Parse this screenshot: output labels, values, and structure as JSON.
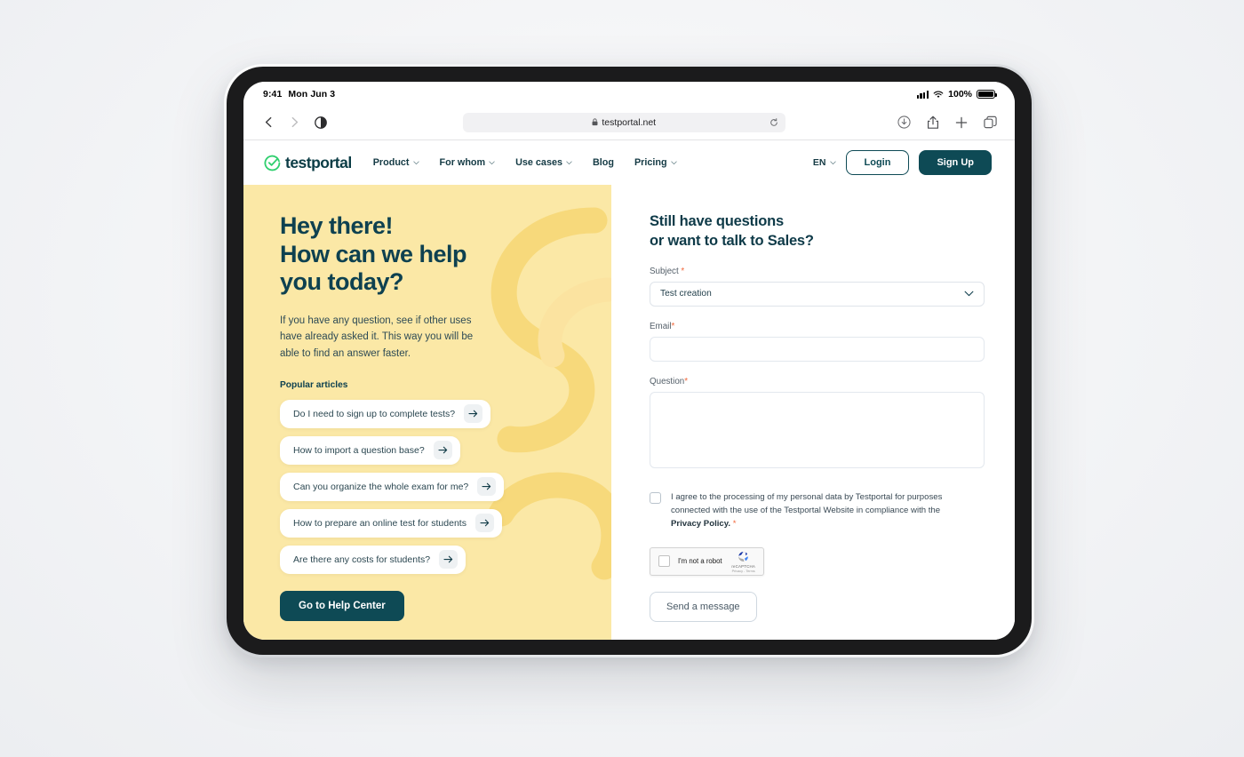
{
  "status_bar": {
    "time": "9:41",
    "date": "Mon Jun 3",
    "battery_percent": "100%",
    "signal_icon": "cellular-bars-icon",
    "wifi_icon": "wifi-icon",
    "battery_icon": "battery-full-icon"
  },
  "browser": {
    "back_icon": "chevron-left-icon",
    "forward_icon": "chevron-right-icon",
    "reader_icon": "reader-mode-icon",
    "lock_icon": "lock-icon",
    "url": "testportal.net",
    "reload_icon": "reload-icon",
    "downloads_icon": "download-icon",
    "share_icon": "share-icon",
    "new_tab_icon": "plus-icon",
    "tabs_icon": "tabs-icon"
  },
  "site_nav": {
    "logo_text": "testportal",
    "logo_icon": "testportal-check-circle-icon",
    "menu": [
      {
        "label": "Product",
        "has_caret": true
      },
      {
        "label": "For whom",
        "has_caret": true
      },
      {
        "label": "Use cases",
        "has_caret": true
      },
      {
        "label": "Blog",
        "has_caret": false
      },
      {
        "label": "Pricing",
        "has_caret": true
      }
    ],
    "language": "EN",
    "language_caret_icon": "chevron-down-icon",
    "login_label": "Login",
    "signup_label": "Sign Up"
  },
  "hero": {
    "heading_line1": "Hey there!",
    "heading_line2": "How can we help",
    "heading_line3": "you today?",
    "paragraph": "If you have any question, see if other uses have already asked it. This way you will be able to find an answer faster.",
    "popular_articles_title": "Popular articles",
    "articles": [
      {
        "label": "Do I need to sign up to complete tests?",
        "arrow_icon": "arrow-right-icon"
      },
      {
        "label": "How to import a question base?",
        "arrow_icon": "arrow-right-icon"
      },
      {
        "label": "Can you organize the whole exam for me?",
        "arrow_icon": "arrow-right-icon"
      },
      {
        "label": "How to prepare an online test for students",
        "arrow_icon": "arrow-right-icon"
      },
      {
        "label": "Are there any costs for students?",
        "arrow_icon": "arrow-right-icon"
      }
    ],
    "help_center_button": "Go to Help Center"
  },
  "form": {
    "heading_line1": "Still have questions",
    "heading_line2": "or want to talk to Sales?",
    "subject_label": "Subject",
    "subject_required": "*",
    "subject_value": "Test creation",
    "subject_caret_icon": "chevron-down-icon",
    "subject_options": [
      "Test creation"
    ],
    "email_label": "Email",
    "email_required": "*",
    "email_value": "",
    "question_label": "Question",
    "question_required": "*",
    "question_value": "",
    "consent_text_1": "I agree to the processing of my personal data by Testportal for purposes connected with the use of the Testportal Website in compliance with the ",
    "consent_link": "Privacy Policy.",
    "consent_required": "*",
    "checkbox_name": "consent-checkbox",
    "recaptcha": {
      "label": "I'm not a robot",
      "brand": "reCAPTCHA",
      "legal": "Privacy - Terms",
      "logo_icon": "recaptcha-logo-icon"
    },
    "submit_label": "Send a message"
  },
  "colors": {
    "hero_bg": "#fbe8a6",
    "swirl": "#f6d777",
    "dark_teal": "#0e4a55",
    "brand_green": "#2ecc71",
    "required_red": "#f2683c"
  }
}
